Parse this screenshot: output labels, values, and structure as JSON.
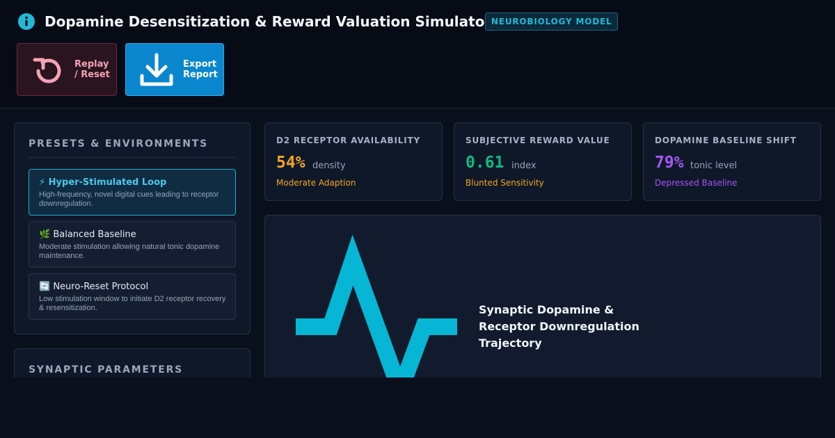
{
  "header": {
    "title": "Dopamine Desensitization & Reward Valuation Simulator",
    "badge": "NEUROBIOLOGY MODEL",
    "icon": "info-icon",
    "accent": "#22b8d8"
  },
  "actions": {
    "reset": {
      "line1": "Replay",
      "line2": "/ Reset",
      "icon": "replay-icon",
      "color": "#f4a3b3"
    },
    "export": {
      "line1": "Export",
      "line2": "Report",
      "icon": "download-icon",
      "color": "#0a86cf"
    }
  },
  "presets": {
    "title": "PRESETS & ENVIRONMENTS",
    "items": [
      {
        "name": "⚡ Hyper-Stimulated Loop",
        "desc": "High-frequency, novel digital cues leading to receptor downregulation.",
        "active": true
      },
      {
        "name": "🌿 Balanced Baseline",
        "desc": "Moderate stimulation allowing natural tonic dopamine maintenance.",
        "active": false
      },
      {
        "name": "🔄 Neuro-Reset Protocol",
        "desc": "Low stimulation window to initiate D2 receptor recovery & resensitization.",
        "active": false
      }
    ]
  },
  "synaptic": {
    "title": "SYNAPTIC PARAMETERS"
  },
  "metrics": [
    {
      "label": "D2 RECEPTOR AVAILABILITY",
      "value": "54%",
      "unit": "density",
      "status": "Moderate Adaption",
      "color": "#f5a524"
    },
    {
      "label": "SUBJECTIVE REWARD VALUE",
      "value": "0.61",
      "unit": "index",
      "status": "Blunted Sensitivity",
      "color": "#10b981"
    },
    {
      "label": "DOPAMINE BASELINE SHIFT",
      "value": "79%",
      "unit": "tonic level",
      "status": "Depressed Baseline",
      "color": "#a855f7"
    }
  ],
  "chart": {
    "caption": "Synaptic Dopamine & Receptor Downregulation Trajectory",
    "icon": "pulse-icon",
    "color": "#06b6d4"
  }
}
